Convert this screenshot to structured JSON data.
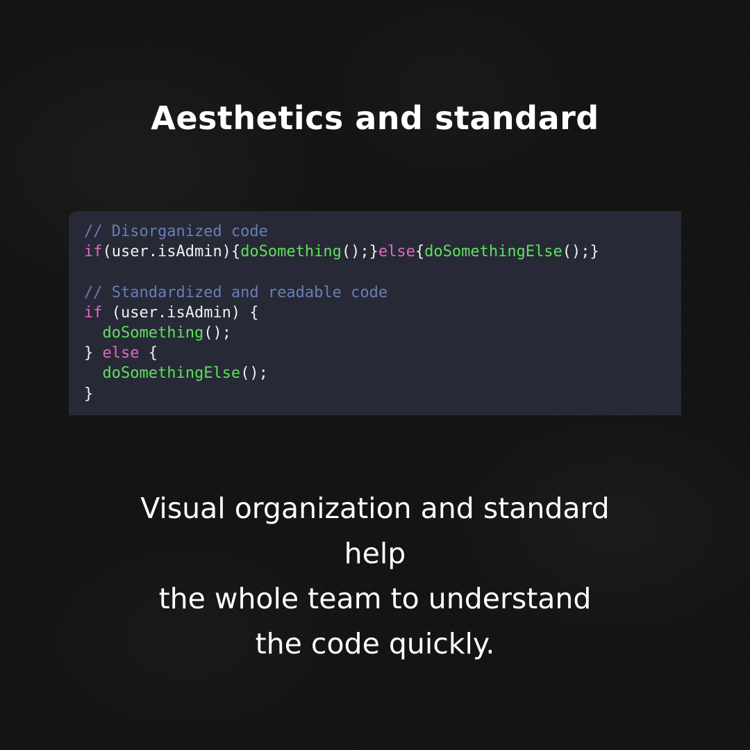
{
  "title": "Aesthetics and standard",
  "code": {
    "lines": [
      [
        {
          "type": "comment",
          "text": "// Disorganized code"
        }
      ],
      [
        {
          "type": "keyword",
          "text": "if"
        },
        {
          "type": "plain",
          "text": "(user.isAdmin){"
        },
        {
          "type": "func",
          "text": "doSomething"
        },
        {
          "type": "plain",
          "text": "();}"
        },
        {
          "type": "keyword",
          "text": "else"
        },
        {
          "type": "plain",
          "text": "{"
        },
        {
          "type": "func",
          "text": "doSomethingElse"
        },
        {
          "type": "plain",
          "text": "();}"
        }
      ],
      [],
      [
        {
          "type": "comment",
          "text": "// Standardized and readable code"
        }
      ],
      [
        {
          "type": "keyword",
          "text": "if"
        },
        {
          "type": "plain",
          "text": " (user.isAdmin) {"
        }
      ],
      [
        {
          "type": "plain",
          "text": "  "
        },
        {
          "type": "func",
          "text": "doSomething"
        },
        {
          "type": "plain",
          "text": "();"
        }
      ],
      [
        {
          "type": "plain",
          "text": "} "
        },
        {
          "type": "keyword",
          "text": "else"
        },
        {
          "type": "plain",
          "text": " {"
        }
      ],
      [
        {
          "type": "plain",
          "text": "  "
        },
        {
          "type": "func",
          "text": "doSomethingElse"
        },
        {
          "type": "plain",
          "text": "();"
        }
      ],
      [
        {
          "type": "plain",
          "text": "}"
        }
      ]
    ]
  },
  "caption": {
    "lines": [
      "Visual organization and standard",
      "help",
      "the whole team to understand",
      "the code quickly."
    ]
  },
  "colors": {
    "background": "#141412",
    "code_panel": "#272a36",
    "comment": "#6a7eb4",
    "keyword": "#ea63c8",
    "function": "#5ee05c",
    "plain": "#f1f1f1",
    "text": "#ffffff"
  }
}
